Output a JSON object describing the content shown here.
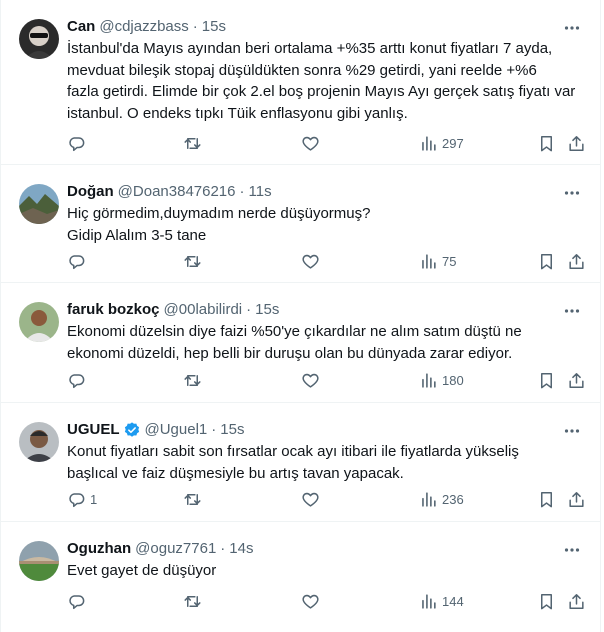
{
  "tweets": [
    {
      "name": "Can",
      "handle": "@cdjazzbass",
      "time": "15s",
      "verified": false,
      "text": "İstanbul'da Mayıs ayından beri ortalama +%35 arttı konut fiyatları 7 ayda,\nmevduat bileşik stopaj düşüldükten sonra %29 getirdi, yani reelde +%6\nfazla getirdi. Elimde bir çok 2.el boş projenin Mayıs Ayı gerçek satış fiyatı var\nistanbul. O endeks tıpkı Tüik enflasyonu gibi yanlış.",
      "replies": "",
      "views": "297"
    },
    {
      "name": "Doğan",
      "handle": "@Doan38476216",
      "time": "11s",
      "verified": false,
      "text": "Hiç görmedim,duymadım nerde düşüyormuş?\nGidip Alalım 3-5 tane",
      "replies": "",
      "views": "75"
    },
    {
      "name": "faruk bozkoç",
      "handle": "@00labilirdi",
      "time": "15s",
      "verified": false,
      "text": "Ekonomi düzelsin diye faizi %50'ye çıkardılar ne alım satım düştü ne\nekonomi düzeldi, hep belli bir duruşu olan bu dünyada zarar ediyor.",
      "replies": "",
      "views": "180"
    },
    {
      "name": "UGUEL",
      "handle": "@Uguel1",
      "time": "15s",
      "verified": true,
      "text": "Konut fiyatları sabit son fırsatlar ocak ayı itibari ile fiyatlarda yükseliş\nbaşlıcal ve faiz düşmesiyle bu artış tavan yapacak.",
      "replies": "1",
      "views": "236"
    },
    {
      "name": "Oguzhan",
      "handle": "@oguz7761",
      "time": "14s",
      "verified": false,
      "text": "Evet gayet de düşüyor",
      "replies": "",
      "views": "144"
    }
  ],
  "separator": "·",
  "colors": {
    "text": "#0f1419",
    "secondary": "#536471",
    "divider": "#eff3f4",
    "verified": "#1d9bf0"
  }
}
